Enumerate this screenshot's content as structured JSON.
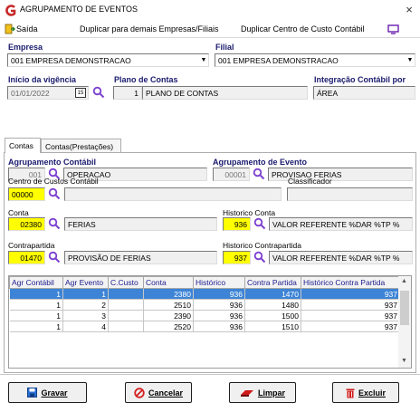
{
  "window": {
    "title": "AGRUPAMENTO DE EVENTOS",
    "close": "×"
  },
  "menu": {
    "exit": "Saída",
    "duplicate_companies": "Duplicar para demais Empresas/Filiais",
    "duplicate_cost_center": "Duplicar Centro de Custo Contábil"
  },
  "header": {
    "empresa_label": "Empresa",
    "empresa_value": "001 EMPRESA DEMONSTRACAO",
    "filial_label": "Filial",
    "filial_value": "001 EMPRESA DEMONSTRACAO",
    "inicio_label": "Início da vigência",
    "inicio_value": "01/01/2022",
    "calendar_glyph": "15",
    "plano_label": "Plano de Contas",
    "plano_code": "1",
    "plano_name": "PLANO DE CONTAS",
    "integracao_label": "Integração Contábil por",
    "integracao_value": "ÁREA"
  },
  "tabs": [
    {
      "label": "Contas"
    },
    {
      "label": "Contas(Prestações)"
    }
  ],
  "form": {
    "agrup_contabil_label": "Agrupamento Contábil",
    "agrup_contabil_code": "001",
    "agrup_contabil_name": "OPERACAO",
    "agrup_evento_label": "Agrupamento de Evento",
    "agrup_evento_code": "00001",
    "agrup_evento_name": "PROVISAO FERIAS",
    "centro_label": "Centro de Custos Contábil",
    "centro_code": "00000",
    "centro_name": "",
    "classificador_label": "Classificador",
    "classificador_value": "",
    "conta_label": "Conta",
    "conta_code": "02380",
    "conta_name": "FERIAS",
    "hist_conta_label": "Historico Conta",
    "hist_conta_code": "936",
    "hist_conta_text": "VALOR REFERENTE %DAR %TP %",
    "contrapartida_label": "Contrapartida",
    "contrapartida_code": "01470",
    "contrapartida_name": "PROVISÃO DE FERIAS",
    "hist_contra_label": "Historico Contrapartida",
    "hist_contra_code": "937",
    "hist_contra_text": "VALOR REFERENTE %DAR %TP %"
  },
  "grid": {
    "columns": [
      "Agr Contábil",
      "Agr Evento",
      "C.Custo",
      "Conta",
      "Histórico",
      "Contra Partida",
      "Histórico Contra Partida"
    ],
    "rows": [
      [
        "1",
        "1",
        "",
        "2380",
        "936",
        "1470",
        "937"
      ],
      [
        "1",
        "2",
        "",
        "2510",
        "936",
        "1480",
        "937"
      ],
      [
        "1",
        "3",
        "",
        "2390",
        "936",
        "1500",
        "937"
      ],
      [
        "1",
        "4",
        "",
        "2520",
        "936",
        "1510",
        "937"
      ]
    ]
  },
  "buttons": {
    "save": "Gravar",
    "cancel": "Cancelar",
    "clear": "Limpar",
    "delete": "Excluir"
  },
  "colors": {
    "accent": "#1a1a6e",
    "selected_row": "#3d84d6",
    "highlight": "#ffff00"
  }
}
